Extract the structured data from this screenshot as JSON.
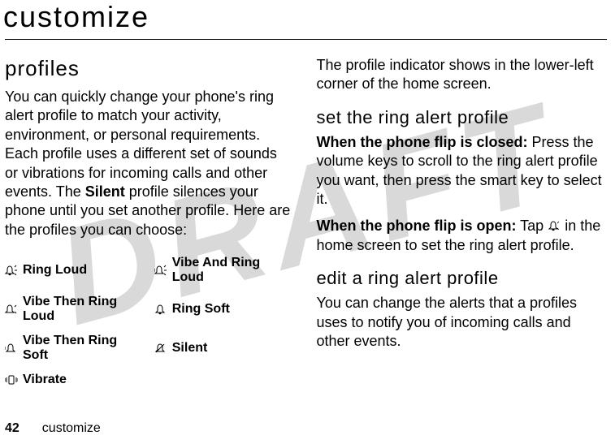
{
  "watermark": "DRAFT",
  "title": "customize",
  "left": {
    "heading": "profiles",
    "body_before_bold": "You can quickly change your phone's ring alert profile to match your activity, environment, or personal requirements. Each profile uses a different set of sounds or vibrations for incoming calls and other events. The ",
    "body_bold": "Silent",
    "body_after_bold": " profile silences your phone until you set another profile. Here are the profiles you can choose:",
    "profiles_col1": [
      "Ring Loud",
      "Vibe Then Ring Loud",
      "Vibe Then Ring Soft",
      "Vibrate"
    ],
    "profiles_col2": [
      "Vibe And Ring Loud",
      "Ring Soft",
      "Silent"
    ]
  },
  "right": {
    "intro": "The profile indicator shows in the lower-left corner of the home screen.",
    "h_set": "set the ring alert profile",
    "closed_bold": "When the phone flip is closed:",
    "closed_rest": " Press the volume keys to scroll to the ring alert profile you want, then press the smart key to select it.",
    "open_bold": "When the phone flip is open:",
    "open_mid": " Tap ",
    "open_rest": " in the home screen to set the ring alert profile.",
    "h_edit": "edit a ring alert profile",
    "edit_body": "You can change the alerts that a profiles uses to notify you of incoming calls and other events."
  },
  "footer": {
    "page": "42",
    "label": "customize"
  }
}
